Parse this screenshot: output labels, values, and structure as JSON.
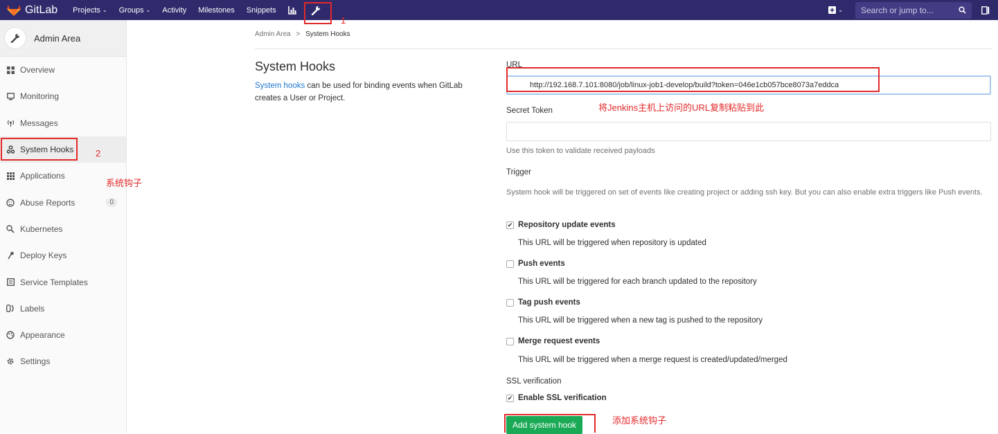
{
  "navbar": {
    "brand": "GitLab",
    "items": [
      {
        "label": "Projects",
        "dropdown": true
      },
      {
        "label": "Groups",
        "dropdown": true
      },
      {
        "label": "Activity",
        "dropdown": false
      },
      {
        "label": "Milestones",
        "dropdown": false
      },
      {
        "label": "Snippets",
        "dropdown": false
      }
    ],
    "search_placeholder": "Search or jump to...",
    "colors": {
      "bg": "#2f2a6b",
      "search_bg": "#433c84"
    }
  },
  "sidebar": {
    "title": "Admin Area",
    "items": [
      {
        "label": "Overview",
        "icon": "grid-icon"
      },
      {
        "label": "Monitoring",
        "icon": "monitor-icon"
      },
      {
        "label": "Messages",
        "icon": "broadcast-icon"
      },
      {
        "label": "System Hooks",
        "icon": "hook-icon",
        "active": true
      },
      {
        "label": "Applications",
        "icon": "apps-icon"
      },
      {
        "label": "Abuse Reports",
        "icon": "abuse-icon",
        "badge": "0"
      },
      {
        "label": "Kubernetes",
        "icon": "kubernetes-icon"
      },
      {
        "label": "Deploy Keys",
        "icon": "key-icon"
      },
      {
        "label": "Service Templates",
        "icon": "template-icon"
      },
      {
        "label": "Labels",
        "icon": "labels-icon"
      },
      {
        "label": "Appearance",
        "icon": "palette-icon"
      },
      {
        "label": "Settings",
        "icon": "gear-icon"
      }
    ]
  },
  "breadcrumb": {
    "parent": "Admin Area",
    "separator": ">",
    "current": "System Hooks"
  },
  "page": {
    "title": "System Hooks",
    "desc_link": "System hooks",
    "desc_rest": " can be used for binding events when GitLab creates a User or Project."
  },
  "form": {
    "url_label": "URL",
    "url_value": "http://192.168.7.101:8080/job/linux-job1-develop/build?token=046e1cb057bce8073a7eddca",
    "token_label": "Secret Token",
    "token_value": "",
    "token_help": "Use this token to validate received payloads",
    "trigger_label": "Trigger",
    "trigger_help": "System hook will be triggered on set of events like creating project or adding ssh key. But you can also enable extra triggers like Push events.",
    "triggers": [
      {
        "label": "Repository update events",
        "desc": "This URL will be triggered when repository is updated",
        "checked": true
      },
      {
        "label": "Push events",
        "desc": "This URL will be triggered for each branch updated to the repository",
        "checked": false
      },
      {
        "label": "Tag push events",
        "desc": "This URL will be triggered when a new tag is pushed to the repository",
        "checked": false
      },
      {
        "label": "Merge request events",
        "desc": "This URL will be triggered when a merge request is created/updated/merged",
        "checked": false
      }
    ],
    "ssl_label": "SSL verification",
    "ssl_checkbox": "Enable SSL verification",
    "ssl_checked": true,
    "submit": "Add system hook",
    "submit_color": "#1aaa55"
  },
  "annotations": {
    "n1": "1",
    "n2": "2",
    "sidebar_note": "系统钩子",
    "url_note": "将Jenkins主机上访问的URL复制粘贴到此",
    "button_note": "添加系统钩子",
    "color": "#e32929"
  }
}
